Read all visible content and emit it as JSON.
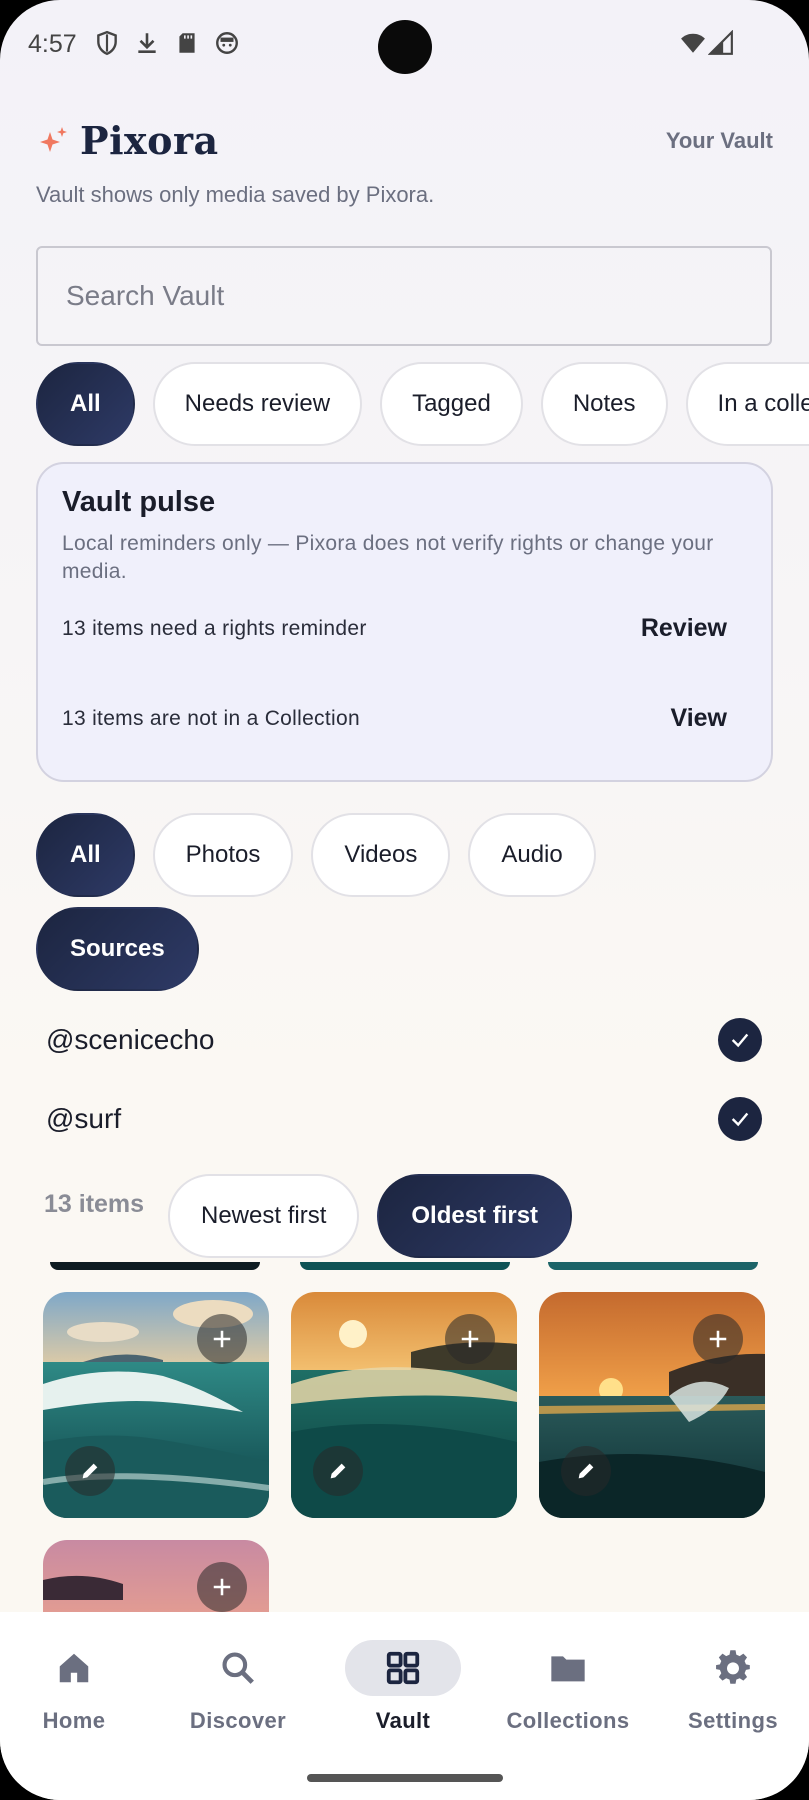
{
  "status_bar": {
    "time": "4:57"
  },
  "header": {
    "app_name": "Pixora",
    "vault_link": "Your Vault",
    "subtitle": "Vault shows only media saved by Pixora."
  },
  "search": {
    "placeholder": "Search Vault",
    "value": ""
  },
  "review_filters": [
    "All",
    "Needs review",
    "Tagged",
    "Notes",
    "In a collection"
  ],
  "pulse": {
    "title": "Vault pulse",
    "description": "Local reminders only — Pixora does not verify rights or change your media.",
    "rights_text": "13 items need a rights reminder",
    "rights_action": "Review",
    "collection_text": "13 items are not in a Collection",
    "collection_action": "View"
  },
  "media_filters": [
    "All",
    "Photos",
    "Videos",
    "Audio"
  ],
  "sources_chip": "Sources",
  "sources": [
    {
      "handle": "@scenicecho",
      "checked": true
    },
    {
      "handle": "@surf",
      "checked": true
    }
  ],
  "results": {
    "count": "13 items",
    "sort_newest": "Newest first",
    "sort_oldest": "Oldest first",
    "sort_selected": "Oldest first"
  },
  "nav": {
    "home": "Home",
    "discover": "Discover",
    "vault": "Vault",
    "collections": "Collections",
    "settings": "Settings",
    "active": "Vault"
  },
  "colors": {
    "accent": "#1c2540",
    "brand_sparkle": "#f07860",
    "muted_text": "#6b6f80"
  }
}
